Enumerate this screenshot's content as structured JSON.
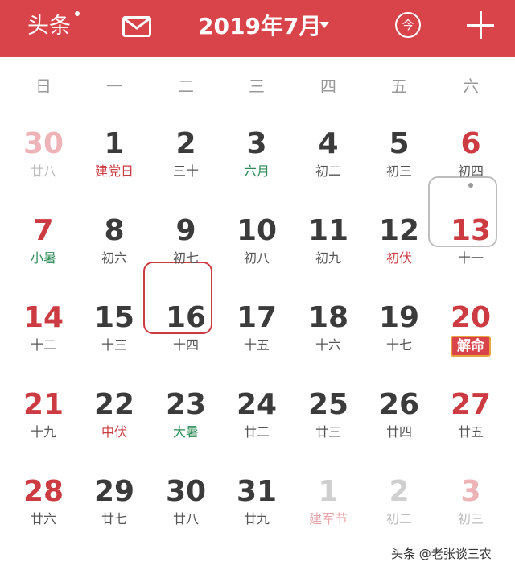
{
  "header": {
    "left_label": "头条",
    "title": "2019年7月",
    "today_label": "今",
    "icons": {
      "mail": "mail-icon",
      "plus": "plus-icon",
      "caret": "caret-down-icon",
      "today": "today-icon"
    }
  },
  "weekdays": [
    "日",
    "一",
    "二",
    "三",
    "四",
    "五",
    "六"
  ],
  "rows": [
    [
      {
        "num": "30",
        "lunar": "廿八",
        "faded": true,
        "red": true,
        "lunar_style": "normal"
      },
      {
        "num": "1",
        "lunar": "建党日",
        "lunar_style": "red"
      },
      {
        "num": "2",
        "lunar": "三十"
      },
      {
        "num": "3",
        "lunar": "六月",
        "lunar_style": "green"
      },
      {
        "num": "4",
        "lunar": "初二"
      },
      {
        "num": "5",
        "lunar": "初三"
      },
      {
        "num": "6",
        "lunar": "初四",
        "red": true,
        "dot": true
      }
    ],
    [
      {
        "num": "7",
        "lunar": "小暑",
        "red": true,
        "lunar_style": "green"
      },
      {
        "num": "8",
        "lunar": "初六"
      },
      {
        "num": "9",
        "lunar": "初七"
      },
      {
        "num": "10",
        "lunar": "初八"
      },
      {
        "num": "11",
        "lunar": "初九"
      },
      {
        "num": "12",
        "lunar": "初伏",
        "lunar_style": "red"
      },
      {
        "num": "13",
        "lunar": "十一",
        "red": true
      }
    ],
    [
      {
        "num": "14",
        "lunar": "十二",
        "red": true
      },
      {
        "num": "15",
        "lunar": "十三"
      },
      {
        "num": "16",
        "lunar": "十四"
      },
      {
        "num": "17",
        "lunar": "十五"
      },
      {
        "num": "18",
        "lunar": "十六"
      },
      {
        "num": "19",
        "lunar": "十七"
      },
      {
        "num": "20",
        "lunar": "解命",
        "red": true,
        "badge": true
      }
    ],
    [
      {
        "num": "21",
        "lunar": "十九",
        "red": true
      },
      {
        "num": "22",
        "lunar": "中伏",
        "lunar_style": "red"
      },
      {
        "num": "23",
        "lunar": "大暑",
        "lunar_style": "green",
        "today": true
      },
      {
        "num": "24",
        "lunar": "廿二"
      },
      {
        "num": "25",
        "lunar": "廿三"
      },
      {
        "num": "26",
        "lunar": "廿四"
      },
      {
        "num": "27",
        "lunar": "廿五",
        "red": true
      }
    ],
    [
      {
        "num": "28",
        "lunar": "廿六",
        "red": true
      },
      {
        "num": "29",
        "lunar": "廿七"
      },
      {
        "num": "30",
        "lunar": "廿八"
      },
      {
        "num": "31",
        "lunar": "廿九"
      },
      {
        "num": "1",
        "lunar": "建军节",
        "faded": true,
        "lunar_style": "red"
      },
      {
        "num": "2",
        "lunar": "初二",
        "faded": true
      },
      {
        "num": "3",
        "lunar": "初三",
        "faded": true,
        "red": true
      }
    ]
  ],
  "watermark": "头条 @老张谈三农"
}
